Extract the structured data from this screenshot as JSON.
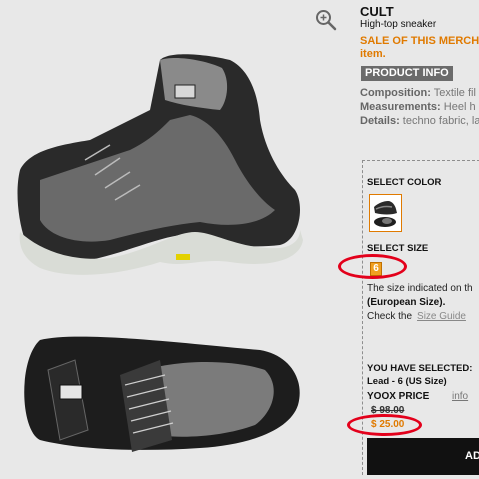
{
  "product": {
    "brand": "CULT",
    "subtitle": "High-top sneaker",
    "sale_line1": "SALE OF THIS MERCHA",
    "sale_line2": "item.",
    "product_info_label": "PRODUCT INFO",
    "composition_label": "Composition:",
    "composition_value": " Textile fil",
    "measurements_label": "Measurements:",
    "measurements_value": " Heel h",
    "details_label": "Details:",
    "details_value": " techno fabric, la"
  },
  "selection": {
    "select_color_label": "SELECT COLOR",
    "select_size_label": "SELECT SIZE",
    "size_value": "6",
    "size_note_line1": "The size indicated on th",
    "size_note_line2": "(European Size).",
    "check_the": "Check the",
    "size_guide_link": "Size Guide",
    "you_have_selected": "YOU HAVE SELECTED:",
    "selected_value": "Lead - 6 (US Size)",
    "price_label": "YOOX PRICE",
    "info_link": "info",
    "old_price": "$ 98.00",
    "new_price": "$ 25.00",
    "add_button": "ADD"
  },
  "colors": {
    "accent": "#e07a00",
    "highlight_oval": "#e3001b",
    "button_bg": "#111111"
  },
  "icons": [
    "zoom-icon"
  ]
}
